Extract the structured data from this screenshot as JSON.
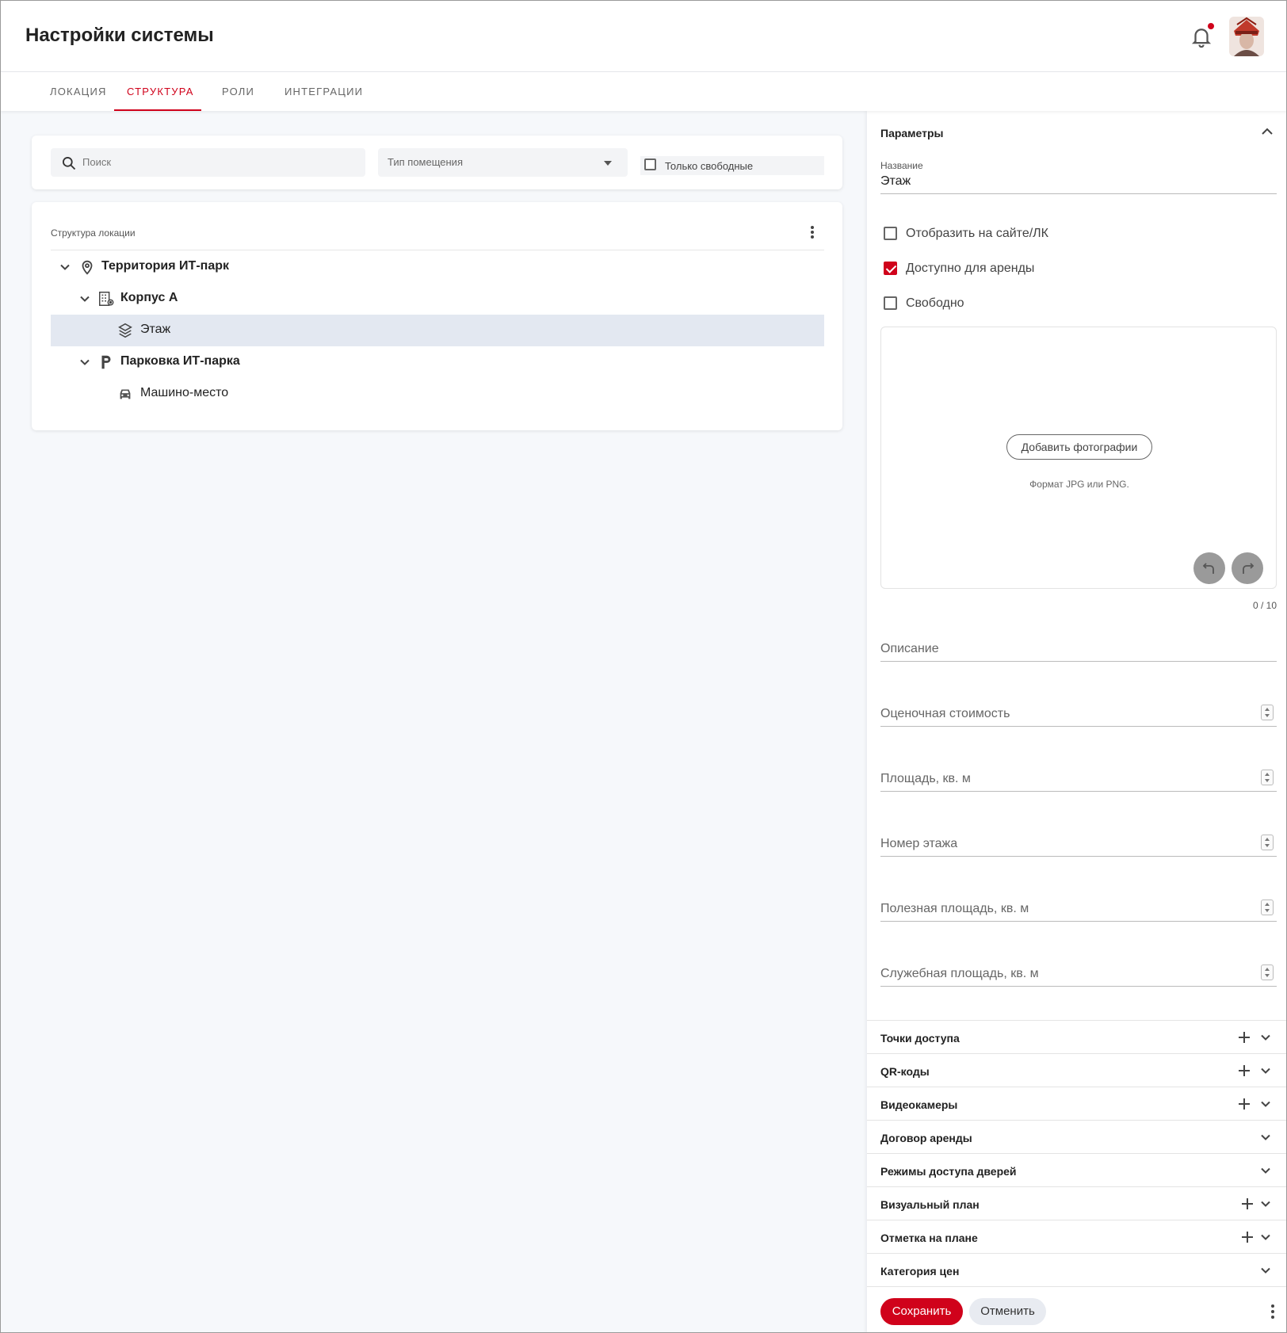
{
  "header": {
    "title": "Настройки системы",
    "notification_dot_color": "#d0021b"
  },
  "tabs": [
    {
      "label": "ЛОКАЦИЯ",
      "active": false
    },
    {
      "label": "СТРУКТУРА",
      "active": true
    },
    {
      "label": "РОЛИ",
      "active": false
    },
    {
      "label": "ИНТЕГРАЦИИ",
      "active": false
    }
  ],
  "filters": {
    "search_placeholder": "Поиск",
    "room_type_placeholder": "Тип помещения",
    "free_only_label": "Только свободные",
    "free_only_checked": false
  },
  "tree": {
    "title": "Структура локации",
    "nodes": [
      {
        "label": "Территория ИТ-парк",
        "icon": "map-pin-icon",
        "level": 0,
        "expanded": true,
        "bold": true
      },
      {
        "label": "Корпус А",
        "icon": "building-icon",
        "level": 1,
        "expanded": true,
        "bold": true
      },
      {
        "label": "Этаж",
        "icon": "layers-icon",
        "level": 2,
        "selected": true,
        "bold": false
      },
      {
        "label": "Парковка ИТ-парка",
        "icon": "parking-icon",
        "level": 1,
        "expanded": true,
        "bold": true
      },
      {
        "label": "Машино-место",
        "icon": "car-icon",
        "level": 2,
        "bold": false
      }
    ]
  },
  "panel": {
    "title": "Параметры",
    "name_label": "Название",
    "name_value": "Этаж",
    "options": [
      {
        "label": "Отобразить на сайте/ЛК",
        "checked": false
      },
      {
        "label": "Доступно для аренды",
        "checked": true
      },
      {
        "label": "Свободно",
        "checked": false
      }
    ],
    "add_photo_label": "Добавить фотографии",
    "photo_hint": "Формат JPG или PNG.",
    "photo_counter": "0 / 10",
    "fields": {
      "description": "Описание",
      "estimated_cost": "Оценочная стоимость",
      "area": "Площадь, кв. м",
      "floor_number": "Номер этажа",
      "useful_area": "Полезная площадь, кв. м",
      "service_area": "Служебная площадь, кв. м"
    },
    "sections": [
      {
        "label": "Точки доступа",
        "has_add": true
      },
      {
        "label": "QR-коды",
        "has_add": true
      },
      {
        "label": "Видеокамеры",
        "has_add": true
      },
      {
        "label": "Договор аренды",
        "has_add": false
      },
      {
        "label": "Режимы доступа дверей",
        "has_add": false
      },
      {
        "label": "Визуальный план",
        "has_add": true
      },
      {
        "label": "Отметка на плане",
        "has_add": true
      },
      {
        "label": "Категория цен",
        "has_add": false
      }
    ],
    "save_label": "Сохранить",
    "cancel_label": "Отменить"
  },
  "colors": {
    "accent": "#d0021b",
    "selected_row": "#e3e8f1",
    "background": "#f6f8fb"
  }
}
